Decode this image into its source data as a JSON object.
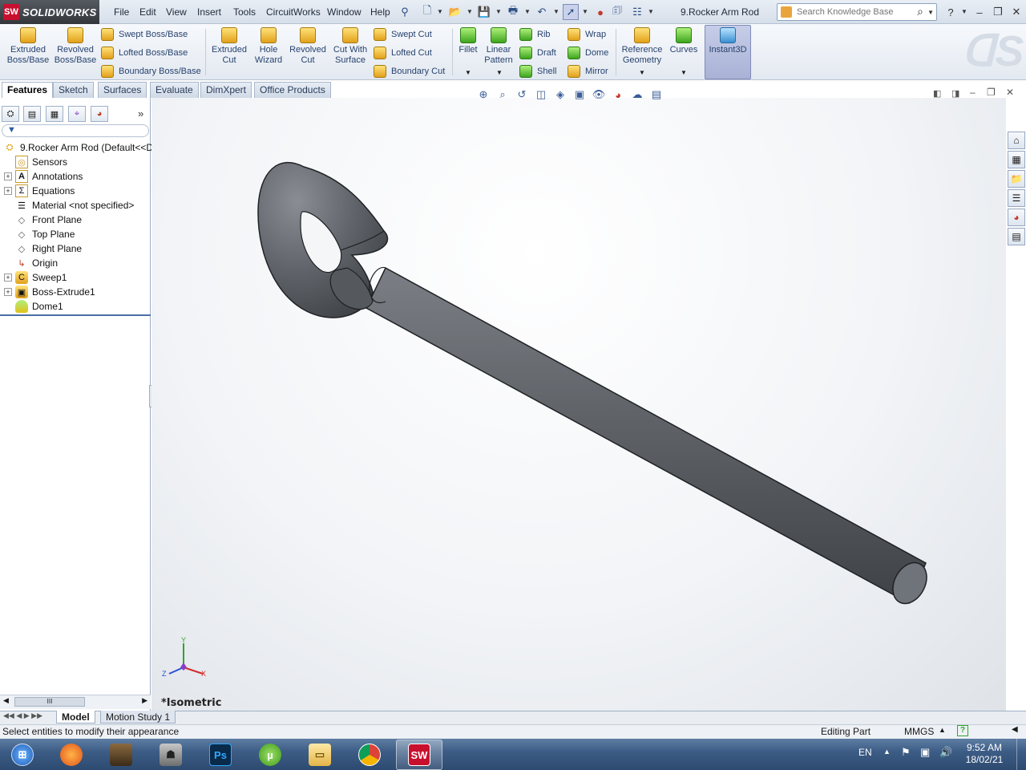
{
  "app": {
    "brand": "SOLIDWORKS",
    "brand_badge": "SW",
    "doc_title": "9.Rocker Arm Rod"
  },
  "menu": [
    "File",
    "Edit",
    "View",
    "Insert",
    "Tools",
    "CircuitWorks",
    "Window",
    "Help"
  ],
  "search": {
    "placeholder": "Search Knowledge Base"
  },
  "ribbon": {
    "extruded_boss": "Extruded Boss/Base",
    "revolved_boss": "Revolved Boss/Base",
    "swept_boss": "Swept Boss/Base",
    "lofted_boss": "Lofted Boss/Base",
    "boundary_boss": "Boundary Boss/Base",
    "extruded_cut": "Extruded Cut",
    "hole_wizard": "Hole Wizard",
    "revolved_cut": "Revolved Cut",
    "cut_with_surface": "Cut With Surface",
    "swept_cut": "Swept Cut",
    "lofted_cut": "Lofted Cut",
    "boundary_cut": "Boundary Cut",
    "fillet": "Fillet",
    "linear_pattern": "Linear Pattern",
    "rib": "Rib",
    "draft": "Draft",
    "shell": "Shell",
    "wrap": "Wrap",
    "dome": "Dome",
    "mirror": "Mirror",
    "reference_geometry": "Reference Geometry",
    "curves": "Curves",
    "instant3d": "Instant3D"
  },
  "tabs": [
    "Features",
    "Sketch",
    "Surfaces",
    "Evaluate",
    "DimXpert",
    "Office Products"
  ],
  "tree": {
    "root": "9.Rocker Arm Rod  (Default<<D",
    "items": [
      {
        "label": "Sensors",
        "expandable": false
      },
      {
        "label": "Annotations",
        "expandable": true
      },
      {
        "label": "Equations",
        "expandable": true
      },
      {
        "label": "Material <not specified>",
        "expandable": false
      },
      {
        "label": "Front Plane",
        "expandable": false
      },
      {
        "label": "Top Plane",
        "expandable": false
      },
      {
        "label": "Right Plane",
        "expandable": false
      },
      {
        "label": "Origin",
        "expandable": false
      },
      {
        "label": "Sweep1",
        "expandable": true
      },
      {
        "label": "Boss-Extrude1",
        "expandable": true
      },
      {
        "label": "Dome1",
        "expandable": false
      }
    ]
  },
  "graphics": {
    "view_label": "*Isometric",
    "axis_x": "X",
    "axis_y": "Y",
    "axis_z": "Z",
    "part_color": "#5f6368"
  },
  "bottom_tabs": [
    "Model",
    "Motion Study 1"
  ],
  "status": {
    "message": "Select entities to modify their appearance",
    "mode": "Editing Part",
    "units": "MMGS"
  },
  "taskbar": {
    "lang": "EN",
    "time": "9:52 AM",
    "date": "18/02/21"
  },
  "fm_scroll_label": "III"
}
